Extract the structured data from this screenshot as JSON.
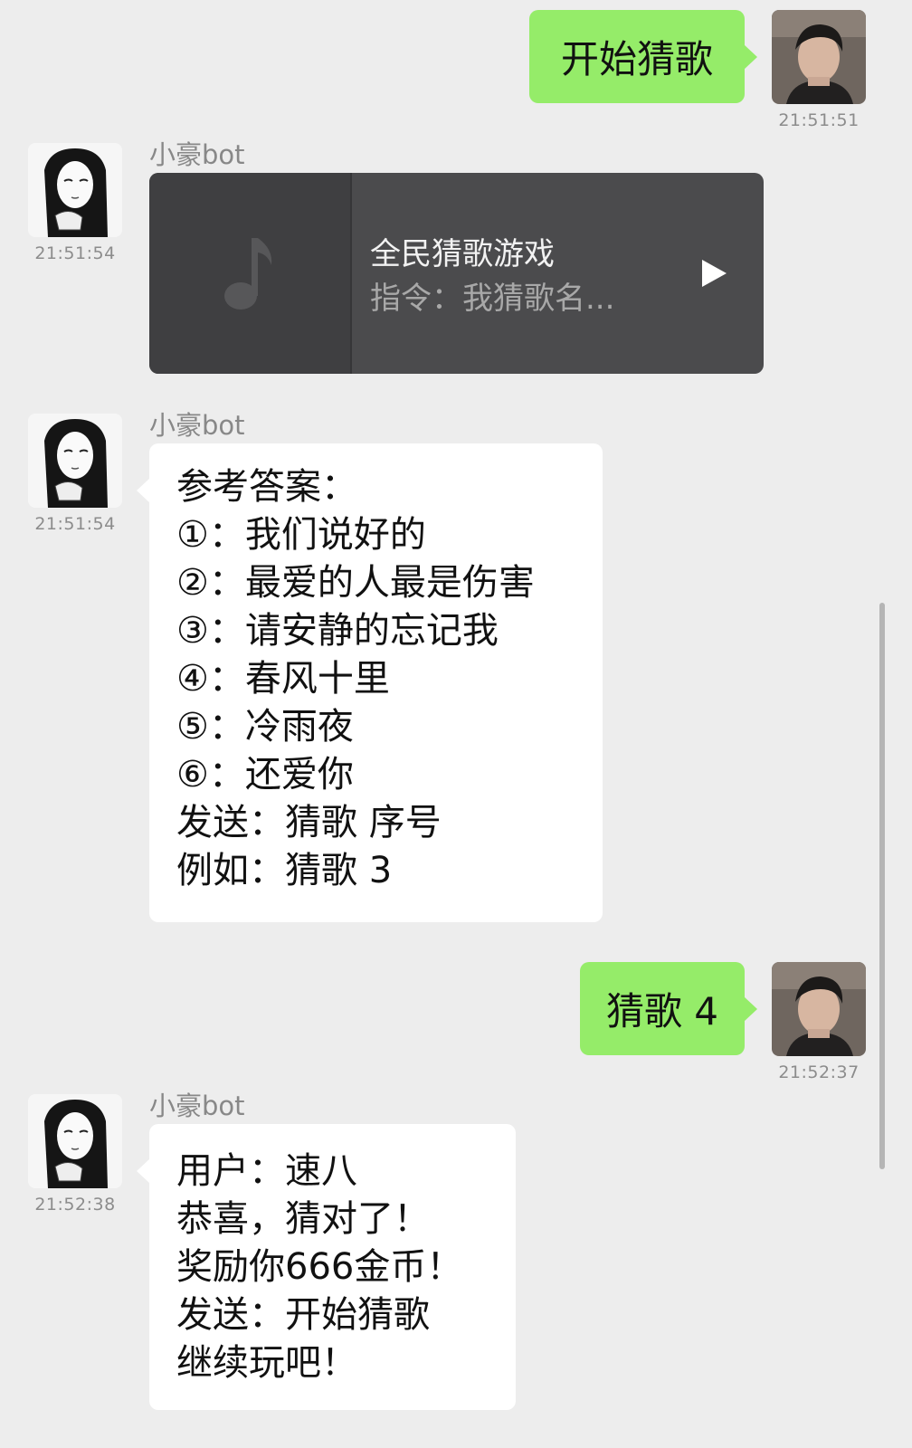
{
  "bot_name": "小豪bot",
  "messages": [
    {
      "side": "right",
      "type": "text",
      "text": "开始猜歌",
      "time": "21:51:51"
    },
    {
      "side": "left",
      "type": "music_card",
      "sender": "小豪bot",
      "time": "21:51:54",
      "card": {
        "title": "全民猜歌游戏",
        "description": "指令：我猜歌名...",
        "cover_icon": "music-note-icon",
        "action_icon": "play-icon"
      }
    },
    {
      "side": "left",
      "type": "text",
      "sender": "小豪bot",
      "time": "21:51:54",
      "lines": [
        "参考答案：",
        "①：我们说好的",
        "②：最爱的人最是伤害",
        "③：请安静的忘记我",
        "④：春风十里",
        "⑤：冷雨夜",
        "⑥：还爱你",
        "发送：猜歌 序号",
        "例如：猜歌 3"
      ]
    },
    {
      "side": "right",
      "type": "text",
      "text": "猜歌 4",
      "time": "21:52:37"
    },
    {
      "side": "left",
      "type": "text",
      "sender": "小豪bot",
      "time": "21:52:38",
      "lines": [
        "用户：速八",
        "恭喜，猜对了！",
        "奖励你666金币！",
        "发送：开始猜歌",
        "继续玩吧！"
      ]
    }
  ],
  "colors": {
    "background": "#ededed",
    "self_bubble": "#95ec69",
    "bot_bubble": "#ffffff",
    "music_card": "#4b4b4d"
  }
}
